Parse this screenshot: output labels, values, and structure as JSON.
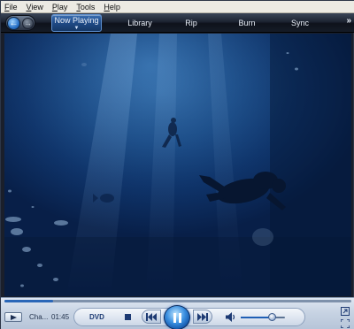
{
  "menu": [
    {
      "label": "File",
      "accel": "F",
      "rest": "ile"
    },
    {
      "label": "View",
      "accel": "V",
      "rest": "iew"
    },
    {
      "label": "Play",
      "accel": "P",
      "rest": "lay"
    },
    {
      "label": "Tools",
      "accel": "T",
      "rest": "ools"
    },
    {
      "label": "Help",
      "accel": "H",
      "rest": "elp"
    }
  ],
  "toolbar": {
    "back_icon": "back-arrow-icon",
    "forward_icon": "forward-arrow-icon",
    "tabs": {
      "now_playing": "Now Playing",
      "library": "Library",
      "rip": "Rip",
      "burn": "Burn",
      "sync": "Sync"
    },
    "more_glyph": "»"
  },
  "transport": {
    "seek_progress": 0.14,
    "chapter_label": "Cha...",
    "elapsed_time": "01:45",
    "source_label": "DVD",
    "volume_level": 0.72
  },
  "colors": {
    "accent": "#2a73c9",
    "tab_active": "#1f4a86"
  }
}
